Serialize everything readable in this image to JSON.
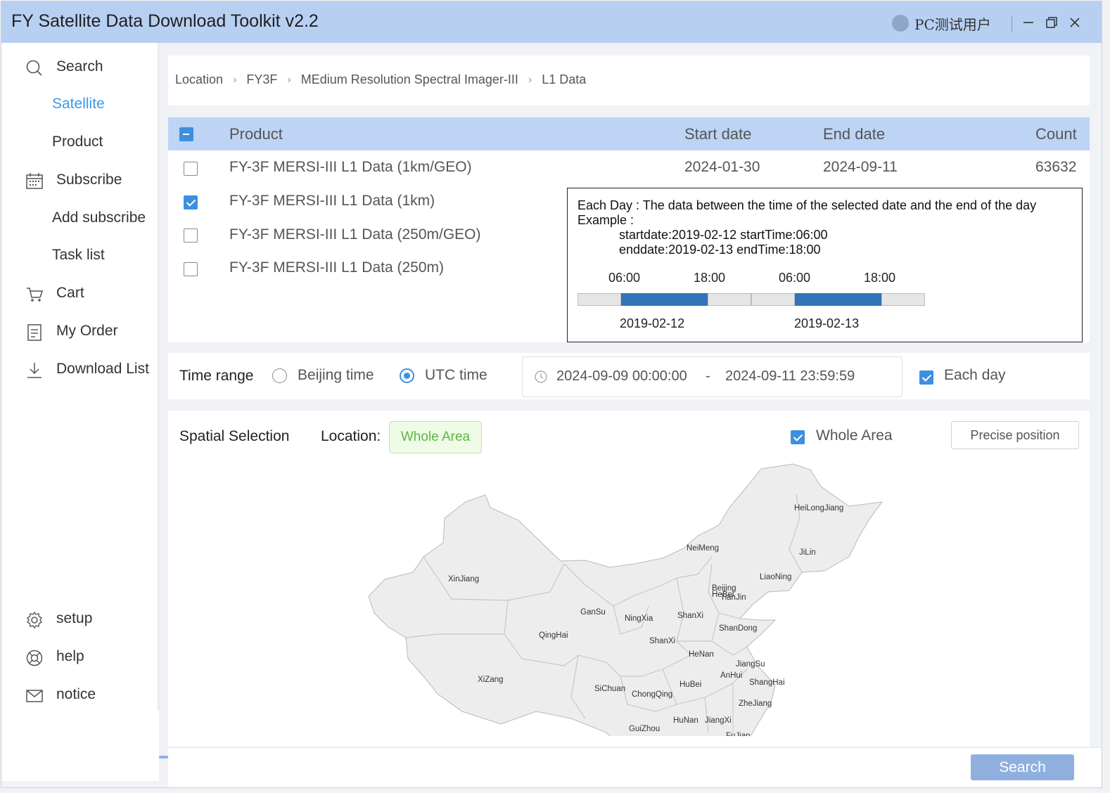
{
  "window": {
    "title": "FY Satellite Data Download Toolkit v2.2",
    "user": "PC测试用户",
    "controls": {
      "minimize": "minimize-icon",
      "restore": "restore-icon",
      "close": "close-icon"
    }
  },
  "sidebar": {
    "items": [
      {
        "label": "Search",
        "icon": "search-icon"
      },
      {
        "label": "Satellite",
        "active": true
      },
      {
        "label": "Product"
      },
      {
        "label": "Subscribe",
        "icon": "calendar-icon"
      },
      {
        "label": "Add subscribe"
      },
      {
        "label": "Task list"
      },
      {
        "label": "Cart",
        "icon": "cart-icon"
      },
      {
        "label": "My Order",
        "icon": "document-icon"
      },
      {
        "label": "Download List",
        "icon": "download-icon"
      },
      {
        "label": "setup",
        "icon": "gear-icon"
      },
      {
        "label": "help",
        "icon": "help-icon"
      },
      {
        "label": "notice",
        "icon": "mail-icon"
      }
    ]
  },
  "breadcrumb": [
    "Location",
    "FY3F",
    "MEdium Resolution Spectral Imager-III",
    "L1 Data"
  ],
  "table": {
    "headers": {
      "product": "Product",
      "start": "Start date",
      "end": "End date",
      "count": "Count"
    },
    "rows": [
      {
        "product": "FY-3F MERSI-III L1 Data (1km/GEO)",
        "start": "2024-01-30",
        "end": "2024-09-11",
        "count": "63632",
        "checked": false
      },
      {
        "product": "FY-3F MERSI-III L1 Data (1km)",
        "checked": true
      },
      {
        "product": "FY-3F MERSI-III L1 Data (250m/GEO)",
        "checked": false
      },
      {
        "product": "FY-3F MERSI-III L1 Data (250m)",
        "checked": false
      }
    ]
  },
  "tooltip": {
    "line1": "Each Day : The data between the time of the selected date and the end of the day",
    "line2": "Example :",
    "line3": "startdate:2019-02-12 startTime:06:00",
    "line4": "enddate:2019-02-13 endTime:18:00",
    "times": [
      "06:00",
      "18:00",
      "06:00",
      "18:00"
    ],
    "dates": [
      "2019-02-12",
      "2019-02-13"
    ],
    "bar_color": "#2f74b8"
  },
  "time_range": {
    "label": "Time range",
    "options": [
      "Beijing time",
      "UTC time"
    ],
    "selected": "UTC time",
    "start": "2024-09-09 00:00:00",
    "separator": "-",
    "end": "2024-09-11 23:59:59",
    "each_day_label": "Each day",
    "each_day_checked": true
  },
  "spatial": {
    "title": "Spatial Selection",
    "location_label": "Location:",
    "location_value": "Whole Area",
    "whole_area_label": "Whole Area",
    "whole_area_checked": true,
    "precise_button": "Precise position"
  },
  "map": {
    "labels": [
      "HeiLongJiang",
      "JiLin",
      "NeiMeng",
      "LiaoNing",
      "XinJiang",
      "Beijing",
      "HeBei",
      "TianJin",
      "GanSu",
      "NingXia",
      "ShanXi",
      "ShanDong",
      "QingHai",
      "ShanXi",
      "HeNan",
      "JiangSu",
      "XiZang",
      "AnHui",
      "ShangHai",
      "HuBei",
      "SiChuan",
      "ChongQing",
      "ZheJiang",
      "HuNan",
      "JiangXi",
      "GuiZhou",
      "FuJian"
    ]
  },
  "footer": {
    "search_button": "Search"
  },
  "colors": {
    "accent": "#3d8fe0",
    "titlebar": "#b7d0f2",
    "table_header": "#bdd4f4",
    "tag_green": "#5fb642"
  }
}
